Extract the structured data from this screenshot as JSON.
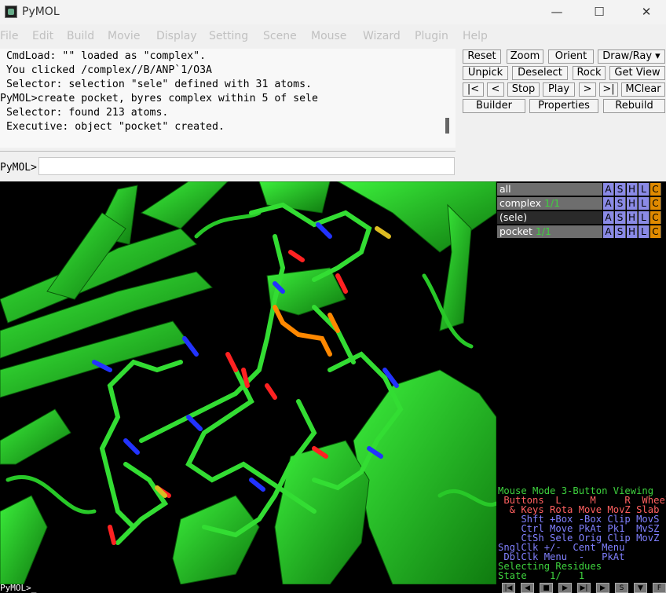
{
  "window": {
    "title": "PyMOL",
    "minimize": "—",
    "maximize": "☐",
    "close": "✕"
  },
  "menu": [
    "File",
    "Edit",
    "Build",
    "Movie",
    "Display",
    "Setting",
    "Scene",
    "Mouse",
    "Wizard",
    "Plugin",
    "Help"
  ],
  "console": {
    "lines": [
      " CmdLoad: \"\" loaded as \"complex\".",
      " You clicked /complex//B/ANP`1/O3A",
      " Selector: selection \"sele\" defined with 31 atoms.",
      "PyMOL>create pocket, byres complex within 5 of sele",
      " Selector: found 213 atoms.",
      " Executive: object \"pocket\" created."
    ],
    "prompt": "PyMOL>",
    "input_value": ""
  },
  "toolbar": {
    "row1": [
      "Reset",
      "Zoom",
      "Orient",
      "Draw/Ray ▾"
    ],
    "row2": [
      "Unpick",
      "Deselect",
      "Rock",
      "Get View"
    ],
    "row3": [
      "|<",
      "<",
      "Stop",
      "Play",
      ">",
      ">|",
      "MClear"
    ],
    "row4": [
      "Builder",
      "Properties",
      "Rebuild"
    ]
  },
  "objects": [
    {
      "name": "all",
      "state": ""
    },
    {
      "name": "complex",
      "state": "1/1"
    },
    {
      "name": "(sele)",
      "state": ""
    },
    {
      "name": "pocket",
      "state": "1/1"
    }
  ],
  "obj_buttons": [
    "A",
    "S",
    "H",
    "L",
    "C"
  ],
  "mouse_panel": {
    "lines": [
      {
        "text": "Mouse Mode 3-Button Viewing",
        "color": "#3ed33e"
      },
      {
        "text": " Buttons  L     M     R  Wheel",
        "color": "#ff6060"
      },
      {
        "text": "  & Keys Rota Move MovZ Slab",
        "color": "#ff6060"
      },
      {
        "text": "    Shft +Box -Box Clip MovS",
        "color": "#8080ff"
      },
      {
        "text": "    Ctrl Move PkAt Pk1  MvSZ",
        "color": "#8080ff"
      },
      {
        "text": "    CtSh Sele Orig Clip MovZ",
        "color": "#8080ff"
      },
      {
        "text": "SnglClk +/-  Cent Menu",
        "color": "#8080ff"
      },
      {
        "text": " DblClk Menu  -   PkAt",
        "color": "#8080ff"
      },
      {
        "text": "Selecting Residues",
        "color": "#3ed33e"
      },
      {
        "text": "State    1/   1",
        "color": "#3ed33e"
      }
    ]
  },
  "status_prompt": "PyMOL>_",
  "transport": [
    "|◀",
    "◀",
    "■",
    "▶",
    "▶|",
    "▶",
    "S",
    "▼",
    "F"
  ],
  "colors": {
    "carbon": "#33dd33",
    "nitrogen": "#2233ff",
    "oxygen": "#ff2222",
    "phosphorus": "#ff8800",
    "sulfur": "#ddbb22"
  }
}
